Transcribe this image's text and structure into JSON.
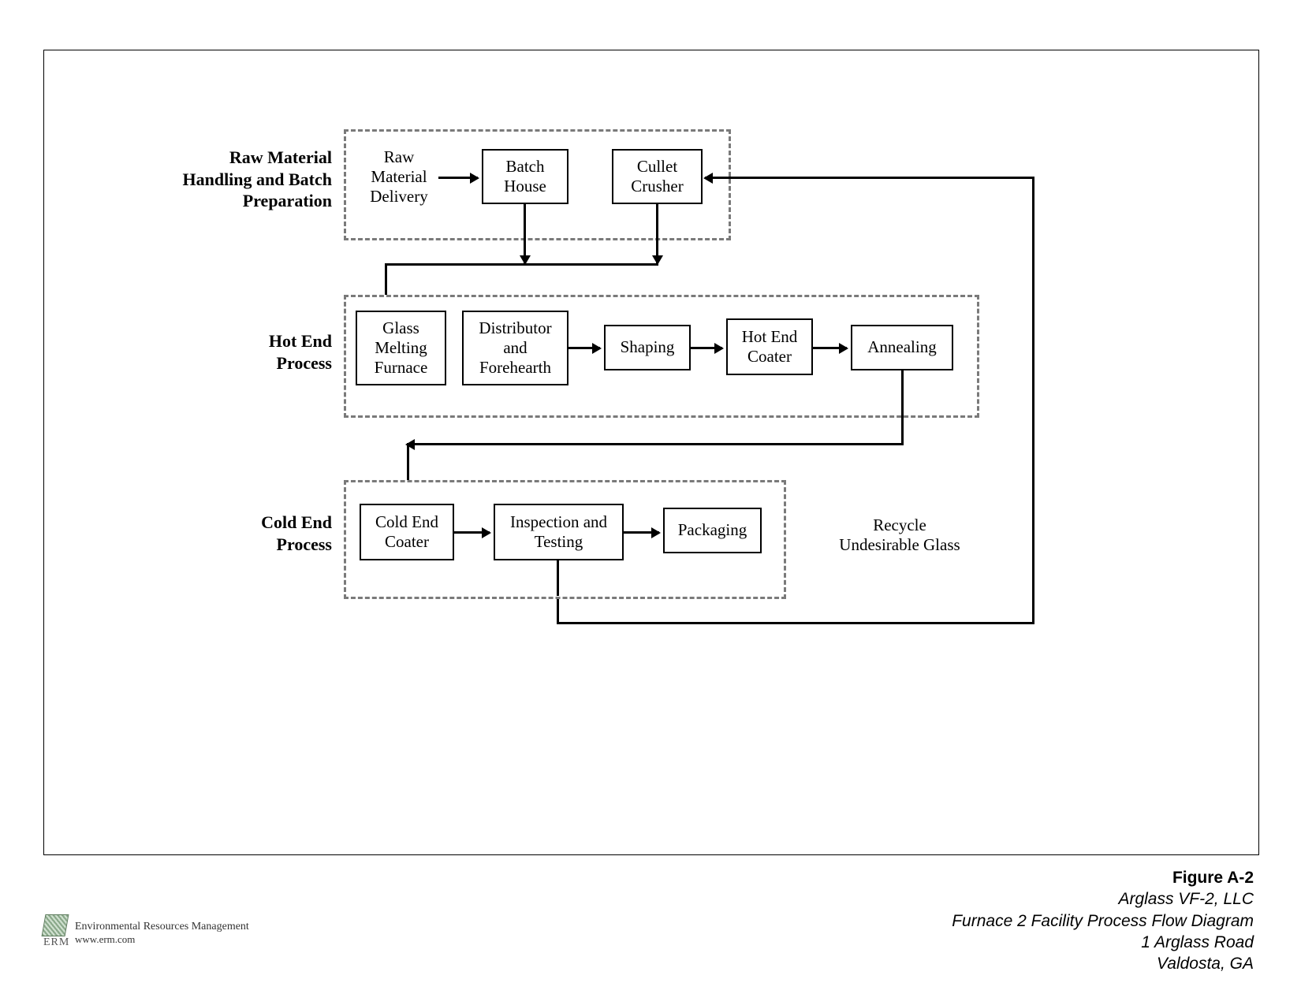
{
  "stages": {
    "raw": {
      "label": "Raw Material\nHandling and Batch\nPreparation",
      "boxes": {
        "delivery": "Raw\nMaterial\nDelivery",
        "batch_house": "Batch\nHouse",
        "cullet_crusher": "Cullet\nCrusher"
      }
    },
    "hot": {
      "label": "Hot End\nProcess",
      "boxes": {
        "furnace": "Glass\nMelting\nFurnace",
        "distributor": "Distributor\nand\nForehearth",
        "shaping": "Shaping",
        "coater": "Hot End\nCoater",
        "annealing": "Annealing"
      }
    },
    "cold": {
      "label": "Cold End\nProcess",
      "boxes": {
        "coater": "Cold End\nCoater",
        "inspection": "Inspection and\nTesting",
        "packaging": "Packaging"
      }
    }
  },
  "recycle_label": "Recycle\nUndesirable Glass",
  "figure": {
    "number": "Figure A-2",
    "company": "Arglass VF-2, LLC",
    "title": "Furnace 2 Facility Process Flow Diagram",
    "address1": "1 Arglass Road",
    "address2": "Valdosta, GA"
  },
  "erm": {
    "company": "Environmental Resources Management",
    "url": "www.erm.com",
    "logo_text": "ERM"
  }
}
